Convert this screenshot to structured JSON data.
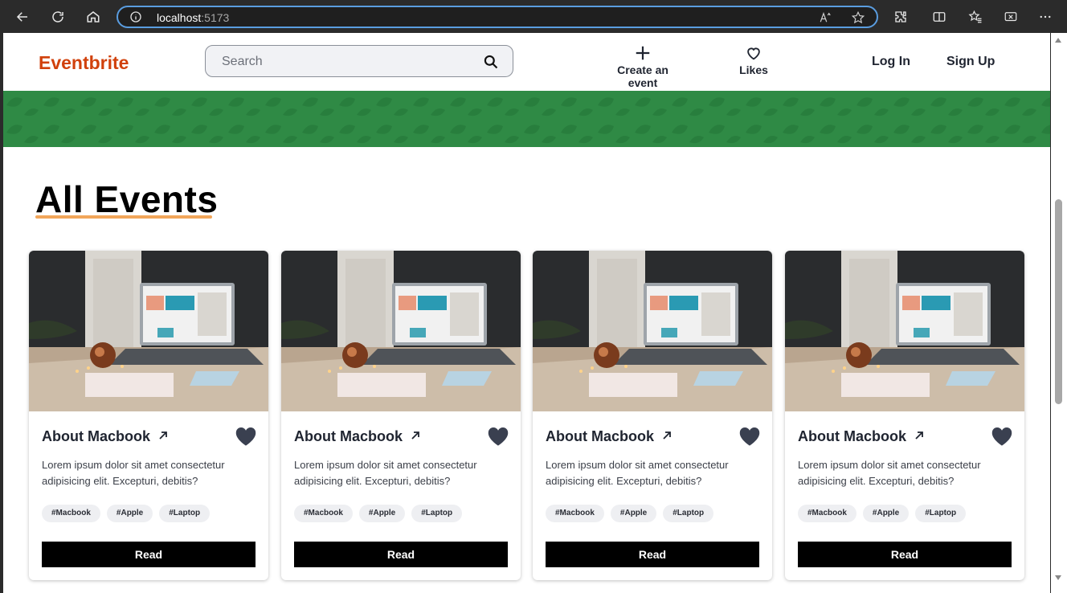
{
  "browser": {
    "url_host": "localhost",
    "url_port": ":5173"
  },
  "header": {
    "logo": "Eventbrite",
    "search_placeholder": "Search",
    "create_label": "Create an event",
    "likes_label": "Likes",
    "login_label": "Log In",
    "signup_label": "Sign Up"
  },
  "colors": {
    "brand": "#d1410c",
    "banner": "#2f8a45",
    "underline": "#f2a65a"
  },
  "section": {
    "title": "All Events"
  },
  "cards": [
    {
      "title": "About Macbook",
      "desc": "Lorem ipsum dolor sit amet consectetur adipisicing elit. Excepturi, debitis?",
      "tags": [
        "#Macbook",
        "#Apple",
        "#Laptop"
      ],
      "button": "Read"
    },
    {
      "title": "About Macbook",
      "desc": "Lorem ipsum dolor sit amet consectetur adipisicing elit. Excepturi, debitis?",
      "tags": [
        "#Macbook",
        "#Apple",
        "#Laptop"
      ],
      "button": "Read"
    },
    {
      "title": "About Macbook",
      "desc": "Lorem ipsum dolor sit amet consectetur adipisicing elit. Excepturi, debitis?",
      "tags": [
        "#Macbook",
        "#Apple",
        "#Laptop"
      ],
      "button": "Read"
    },
    {
      "title": "About Macbook",
      "desc": "Lorem ipsum dolor sit amet consectetur adipisicing elit. Excepturi, debitis?",
      "tags": [
        "#Macbook",
        "#Apple",
        "#Laptop"
      ],
      "button": "Read"
    }
  ]
}
